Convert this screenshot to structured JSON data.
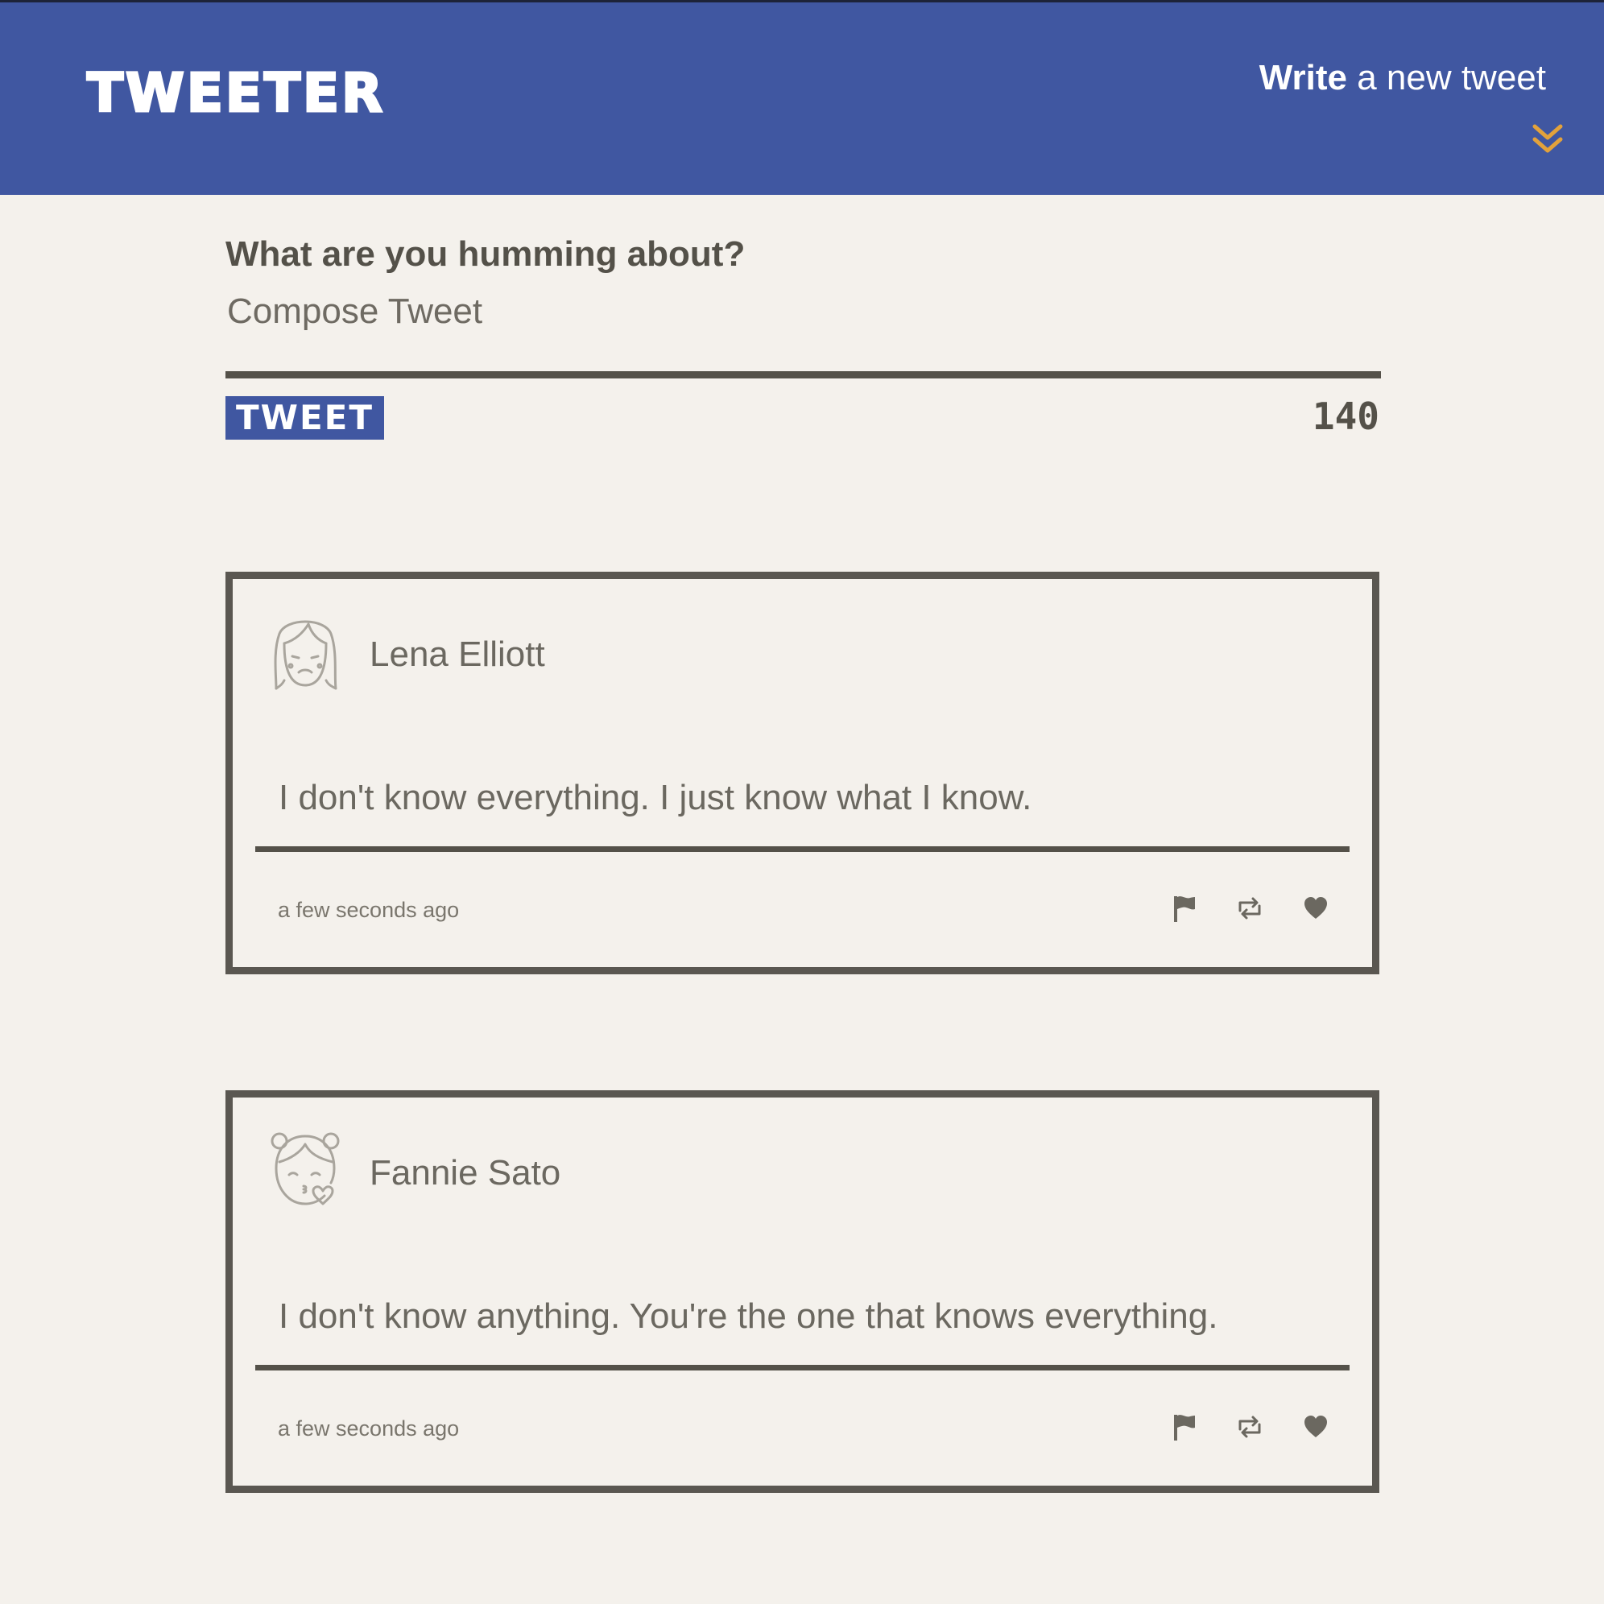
{
  "header": {
    "logo": "TWEETER",
    "write_strong": "Write",
    "write_rest": "a new tweet",
    "toggle_icon": "double-chevron-down-icon",
    "accent_color": "#e3a23b",
    "bar_color": "#4057a1"
  },
  "composer": {
    "heading": "What are you humming about?",
    "placeholder": "Compose Tweet",
    "value": "",
    "submit_label": "TWEET",
    "counter": "140"
  },
  "tweets": [
    {
      "user_name": "Lena Elliott",
      "avatar_icon": "sad-girl-avatar-icon",
      "text": "I don't know everything. I just know what I know.",
      "timestamp": "a few seconds ago",
      "actions": [
        "flag-icon",
        "retweet-icon",
        "heart-icon"
      ]
    },
    {
      "user_name": "Fannie Sato",
      "avatar_icon": "kissing-girl-avatar-icon",
      "text": "I don't know anything. You're the one that knows everything.",
      "timestamp": "a few seconds ago",
      "actions": [
        "flag-icon",
        "retweet-icon",
        "heart-icon"
      ]
    }
  ],
  "colors": {
    "background": "#f4f1ec",
    "text": "#545149",
    "button": "#4057a1"
  }
}
